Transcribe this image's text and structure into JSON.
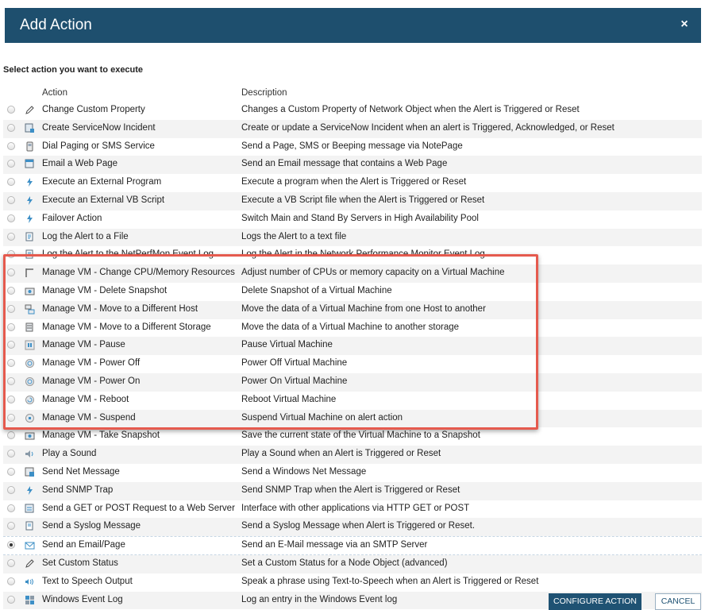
{
  "dialog": {
    "title": "Add Action",
    "close_label": "×"
  },
  "prompt": "Select action you want to execute",
  "columns": {
    "action": "Action",
    "description": "Description"
  },
  "rows": [
    {
      "action": "Change Custom Property",
      "description": "Changes a Custom Property of Network Object when the Alert is Triggered or Reset",
      "icon": "pencil-icon",
      "selected": false
    },
    {
      "action": "Create ServiceNow Incident",
      "description": "Create or update a ServiceNow Incident when an alert is Triggered, Acknowledged, or Reset",
      "icon": "incident-icon",
      "selected": false
    },
    {
      "action": "Dial Paging or SMS Service",
      "description": "Send a Page, SMS or Beeping message via NotePage",
      "icon": "pager-icon",
      "selected": false
    },
    {
      "action": "Email a Web Page",
      "description": "Send an Email message that contains a Web Page",
      "icon": "web-page-icon",
      "selected": false
    },
    {
      "action": "Execute an External Program",
      "description": "Execute a program when the Alert is Triggered or Reset",
      "icon": "lightning-icon",
      "selected": false
    },
    {
      "action": "Execute an External VB Script",
      "description": "Execute a VB Script file when the Alert is Triggered or Reset",
      "icon": "lightning-icon",
      "selected": false
    },
    {
      "action": "Failover Action",
      "description": "Switch Main and Stand By Servers in High Availability Pool",
      "icon": "lightning-icon",
      "selected": false
    },
    {
      "action": "Log the Alert to a File",
      "description": "Logs the Alert to a text file",
      "icon": "log-file-icon",
      "selected": false
    },
    {
      "action": "Log the Alert to the NetPerfMon Event Log",
      "description": "Log the Alert in the Network Performance Monitor Event Log",
      "icon": "log-file-icon",
      "selected": false
    },
    {
      "action": "Manage VM - Change CPU/Memory Resources",
      "description": "Adjust number of CPUs or memory capacity on a Virtual Machine",
      "icon": "vm-resources-icon",
      "selected": false
    },
    {
      "action": "Manage VM - Delete Snapshot",
      "description": "Delete Snapshot of a Virtual Machine",
      "icon": "vm-snapshot-icon",
      "selected": false
    },
    {
      "action": "Manage VM - Move to a Different Host",
      "description": "Move the data of a Virtual Machine from one Host to another",
      "icon": "vm-host-icon",
      "selected": false
    },
    {
      "action": "Manage VM - Move to a Different Storage",
      "description": "Move the data of a Virtual Machine to another storage",
      "icon": "vm-storage-icon",
      "selected": false
    },
    {
      "action": "Manage VM - Pause",
      "description": "Pause Virtual Machine",
      "icon": "vm-pause-icon",
      "selected": false
    },
    {
      "action": "Manage VM - Power Off",
      "description": "Power Off Virtual Machine",
      "icon": "vm-power-icon",
      "selected": false
    },
    {
      "action": "Manage VM - Power On",
      "description": "Power On Virtual Machine",
      "icon": "vm-power-icon",
      "selected": false
    },
    {
      "action": "Manage VM - Reboot",
      "description": "Reboot Virtual Machine",
      "icon": "vm-reboot-icon",
      "selected": false
    },
    {
      "action": "Manage VM - Suspend",
      "description": "Suspend Virtual Machine on alert action",
      "icon": "vm-suspend-icon",
      "selected": false
    },
    {
      "action": "Manage VM - Take Snapshot",
      "description": "Save the current state of the Virtual Machine to a Snapshot",
      "icon": "vm-snapshot-icon",
      "selected": false
    },
    {
      "action": "Play a Sound",
      "description": "Play a Sound when an Alert is Triggered or Reset",
      "icon": "speaker-icon",
      "selected": false
    },
    {
      "action": "Send Net Message",
      "description": "Send a Windows Net Message",
      "icon": "net-message-icon",
      "selected": false
    },
    {
      "action": "Send SNMP Trap",
      "description": "Send SNMP Trap when the Alert is Triggered or Reset",
      "icon": "lightning-icon",
      "selected": false
    },
    {
      "action": "Send a GET or POST Request to a Web Server",
      "description": "Interface with other applications via HTTP GET or POST",
      "icon": "web-request-icon",
      "selected": false
    },
    {
      "action": "Send a Syslog Message",
      "description": "Send a Syslog Message when Alert is Triggered or Reset.",
      "icon": "syslog-icon",
      "selected": false
    },
    {
      "action": "Send an Email/Page",
      "description": "Send an E-Mail message via an SMTP Server",
      "icon": "envelope-icon",
      "selected": true
    },
    {
      "action": "Set Custom Status",
      "description": "Set a Custom Status for a Node Object (advanced)",
      "icon": "pencil-icon",
      "selected": false
    },
    {
      "action": "Text to Speech Output",
      "description": "Speak a phrase using Text-to-Speech when an Alert is Triggered or Reset",
      "icon": "speech-icon",
      "selected": false
    },
    {
      "action": "Windows Event Log",
      "description": "Log an entry in the Windows Event log",
      "icon": "event-log-icon",
      "selected": false
    }
  ],
  "buttons": {
    "configure": "CONFIGURE ACTION",
    "cancel": "CANCEL"
  },
  "colors": {
    "header_bg": "#1e4f6e",
    "highlight_border": "#e55a4e",
    "icon_blue": "#3d8fc6"
  }
}
